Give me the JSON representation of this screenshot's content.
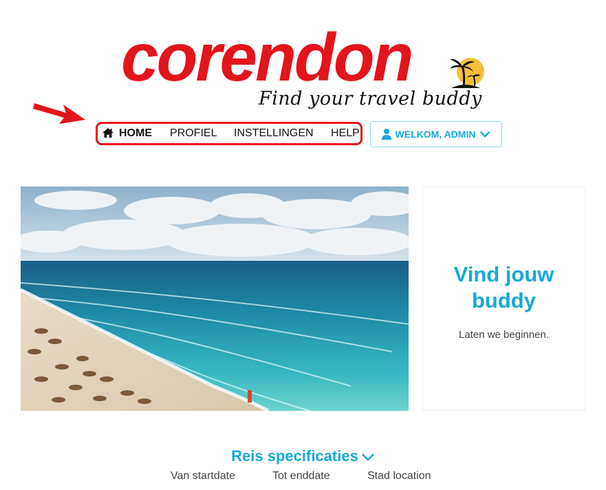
{
  "brand": {
    "name": "corendon",
    "tagline": "Find your travel buddy",
    "color": "#e3141b"
  },
  "nav": {
    "items": [
      {
        "label": "HOME",
        "icon": "home-icon",
        "active": true
      },
      {
        "label": "PROFIEL"
      },
      {
        "label": "INSTELLINGEN"
      },
      {
        "label": "HELP"
      }
    ],
    "highlight_color": "#e3141b"
  },
  "user_menu": {
    "label": "WELKOM, ADMIN",
    "icon": "user-icon",
    "caret_icon": "chevron-down-icon",
    "accent": "#16a9d7"
  },
  "hero": {
    "image": "beach-photo",
    "title": "Vind jouw buddy",
    "subtitle": "Laten we beginnen."
  },
  "specs": {
    "title": "Reis specificaties",
    "caret_icon": "chevron-down-icon",
    "labels": {
      "start": "Van startdate",
      "end": "Tot enddate",
      "location": "Stad location"
    }
  }
}
